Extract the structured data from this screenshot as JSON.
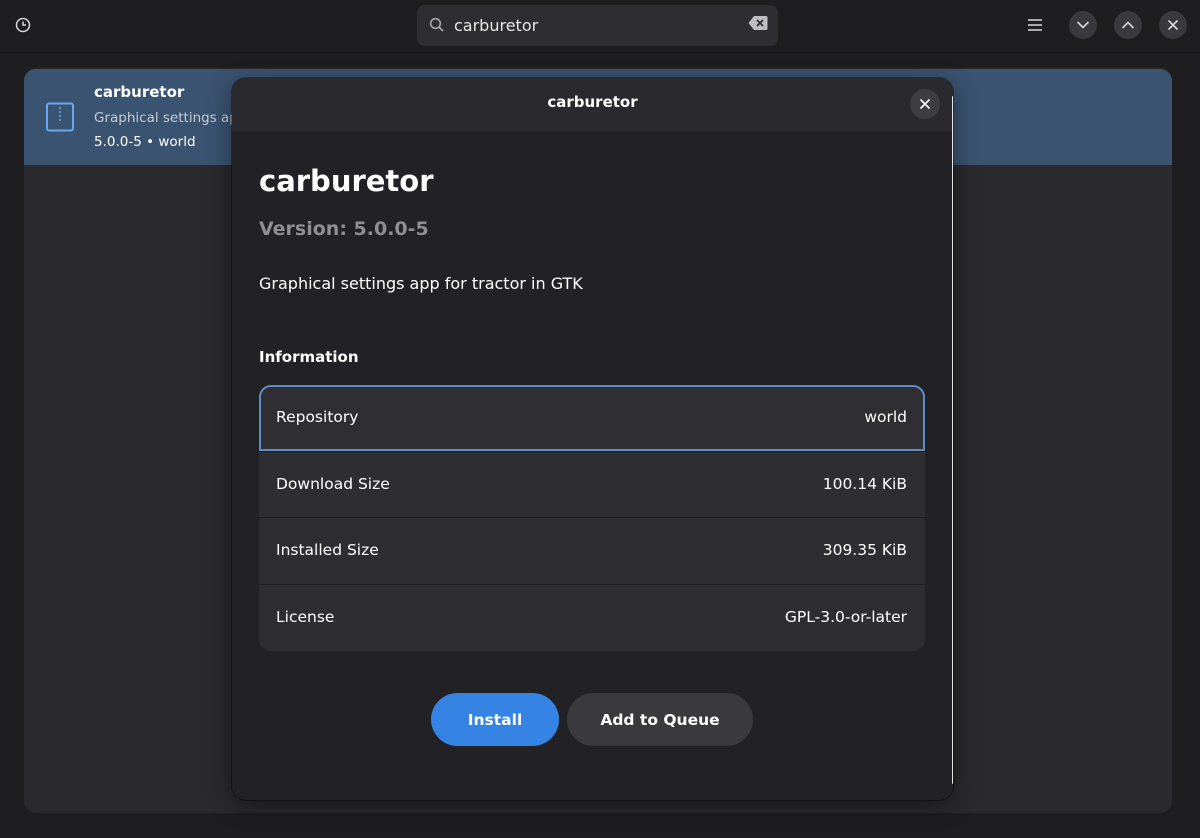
{
  "search": {
    "value": "carburetor"
  },
  "result": {
    "title": "carburetor",
    "description": "Graphical settings app",
    "meta": "5.0.0-5 • world"
  },
  "dialog": {
    "title": "carburetor",
    "name": "carburetor",
    "version": "Version: 5.0.0-5",
    "summary": "Graphical settings app for tractor in GTK",
    "info_heading": "Information",
    "info": [
      {
        "key": "Repository",
        "value": "world"
      },
      {
        "key": "Download Size",
        "value": "100.14 KiB"
      },
      {
        "key": "Installed Size",
        "value": "309.35 KiB"
      },
      {
        "key": "License",
        "value": "GPL-3.0-or-later"
      }
    ],
    "install_label": "Install",
    "queue_label": "Add to Queue"
  },
  "colors": {
    "accent": "#3584e4",
    "selected_row": "#3a5371",
    "focus_ring": "#5b8cc6"
  }
}
